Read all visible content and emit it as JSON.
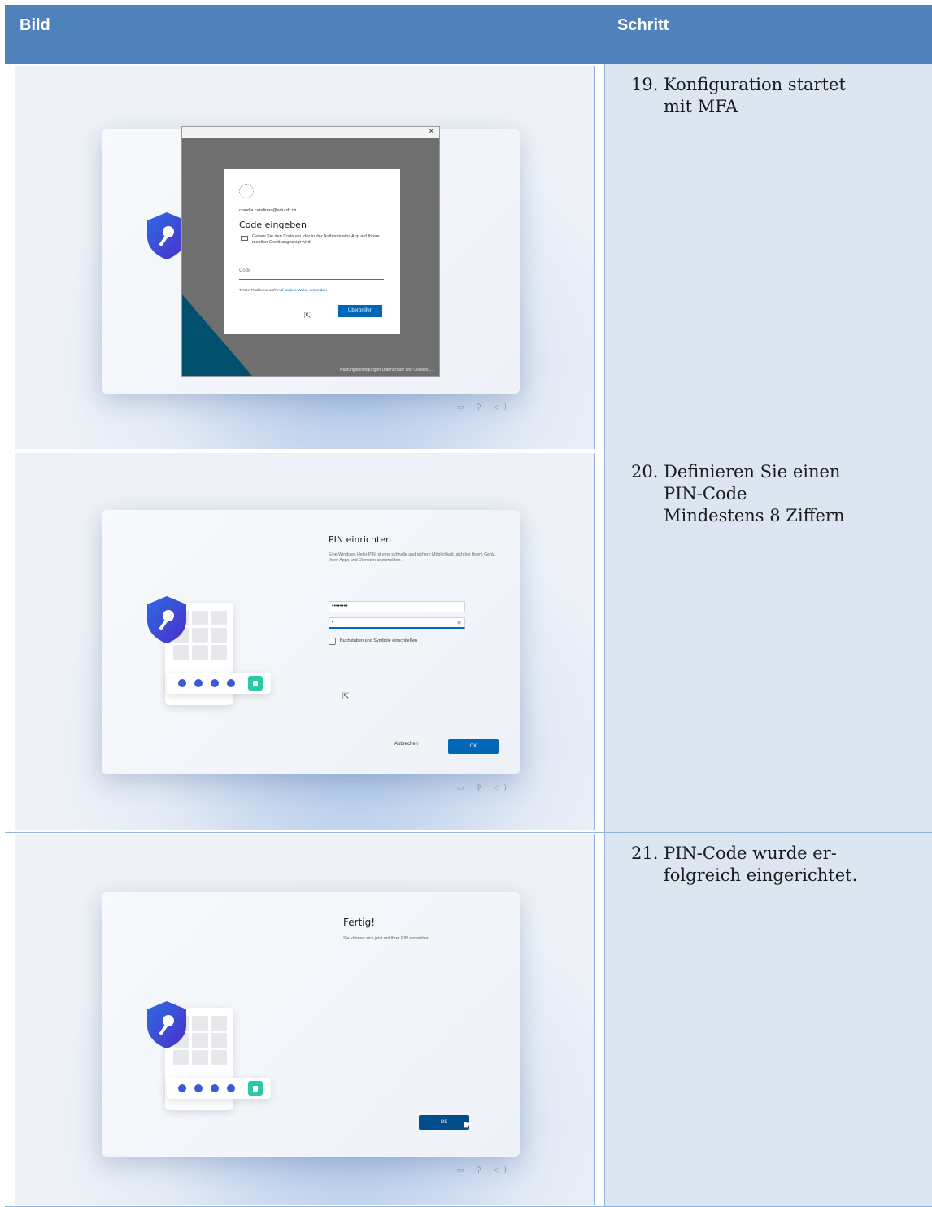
{
  "header": {
    "col_image": "Bild",
    "col_step": "Schritt"
  },
  "steps": [
    {
      "number": "19.",
      "lines": [
        "Konfiguration startet",
        "mit MFA"
      ],
      "screenshot": {
        "dialog_email": "claudia.candinas@edu.zh.ch",
        "dialog_title": "Code eingeben",
        "dialog_desc": "Geben Sie den Code ein, der in der Authenticator-App auf Ihrem mobilen Gerät angezeigt wird",
        "code_placeholder": "Code",
        "trouble_text": "Treten Probleme auf?",
        "trouble_link": "Auf andere Weise anmelden",
        "verify_button": "Überprüfen",
        "footer": "Nutzungsbedingungen   Datenschutz und Cookies   ..."
      }
    },
    {
      "number": "20.",
      "lines": [
        "Definieren Sie einen",
        "PIN-Code",
        "Mindestens 8 Ziffern"
      ],
      "screenshot": {
        "title": "PIN einrichten",
        "desc": "Eine Windows Hello-PIN ist eine schnelle und sichere Möglichkeit, sich bei Ihrem Gerät, Ihren Apps und Diensten anzumelden.",
        "pin_value": "••••••••",
        "confirm_value": "•",
        "checkbox_label": "Buchstaben und Symbole einschließen",
        "cancel_button": "Abbrechen",
        "ok_button": "OK"
      }
    },
    {
      "number": "21.",
      "lines": [
        "PIN-Code wurde er-",
        "folgreich eingerichtet."
      ],
      "screenshot": {
        "title": "Fertig!",
        "desc": "Sie können sich jetzt mit Ihrer PIN anmelden.",
        "ok_button": "OK"
      }
    }
  ],
  "colors": {
    "header_bg": "#4f81bd",
    "step_cell_bg": "#dce6f1",
    "button_blue": "#0067b8"
  }
}
